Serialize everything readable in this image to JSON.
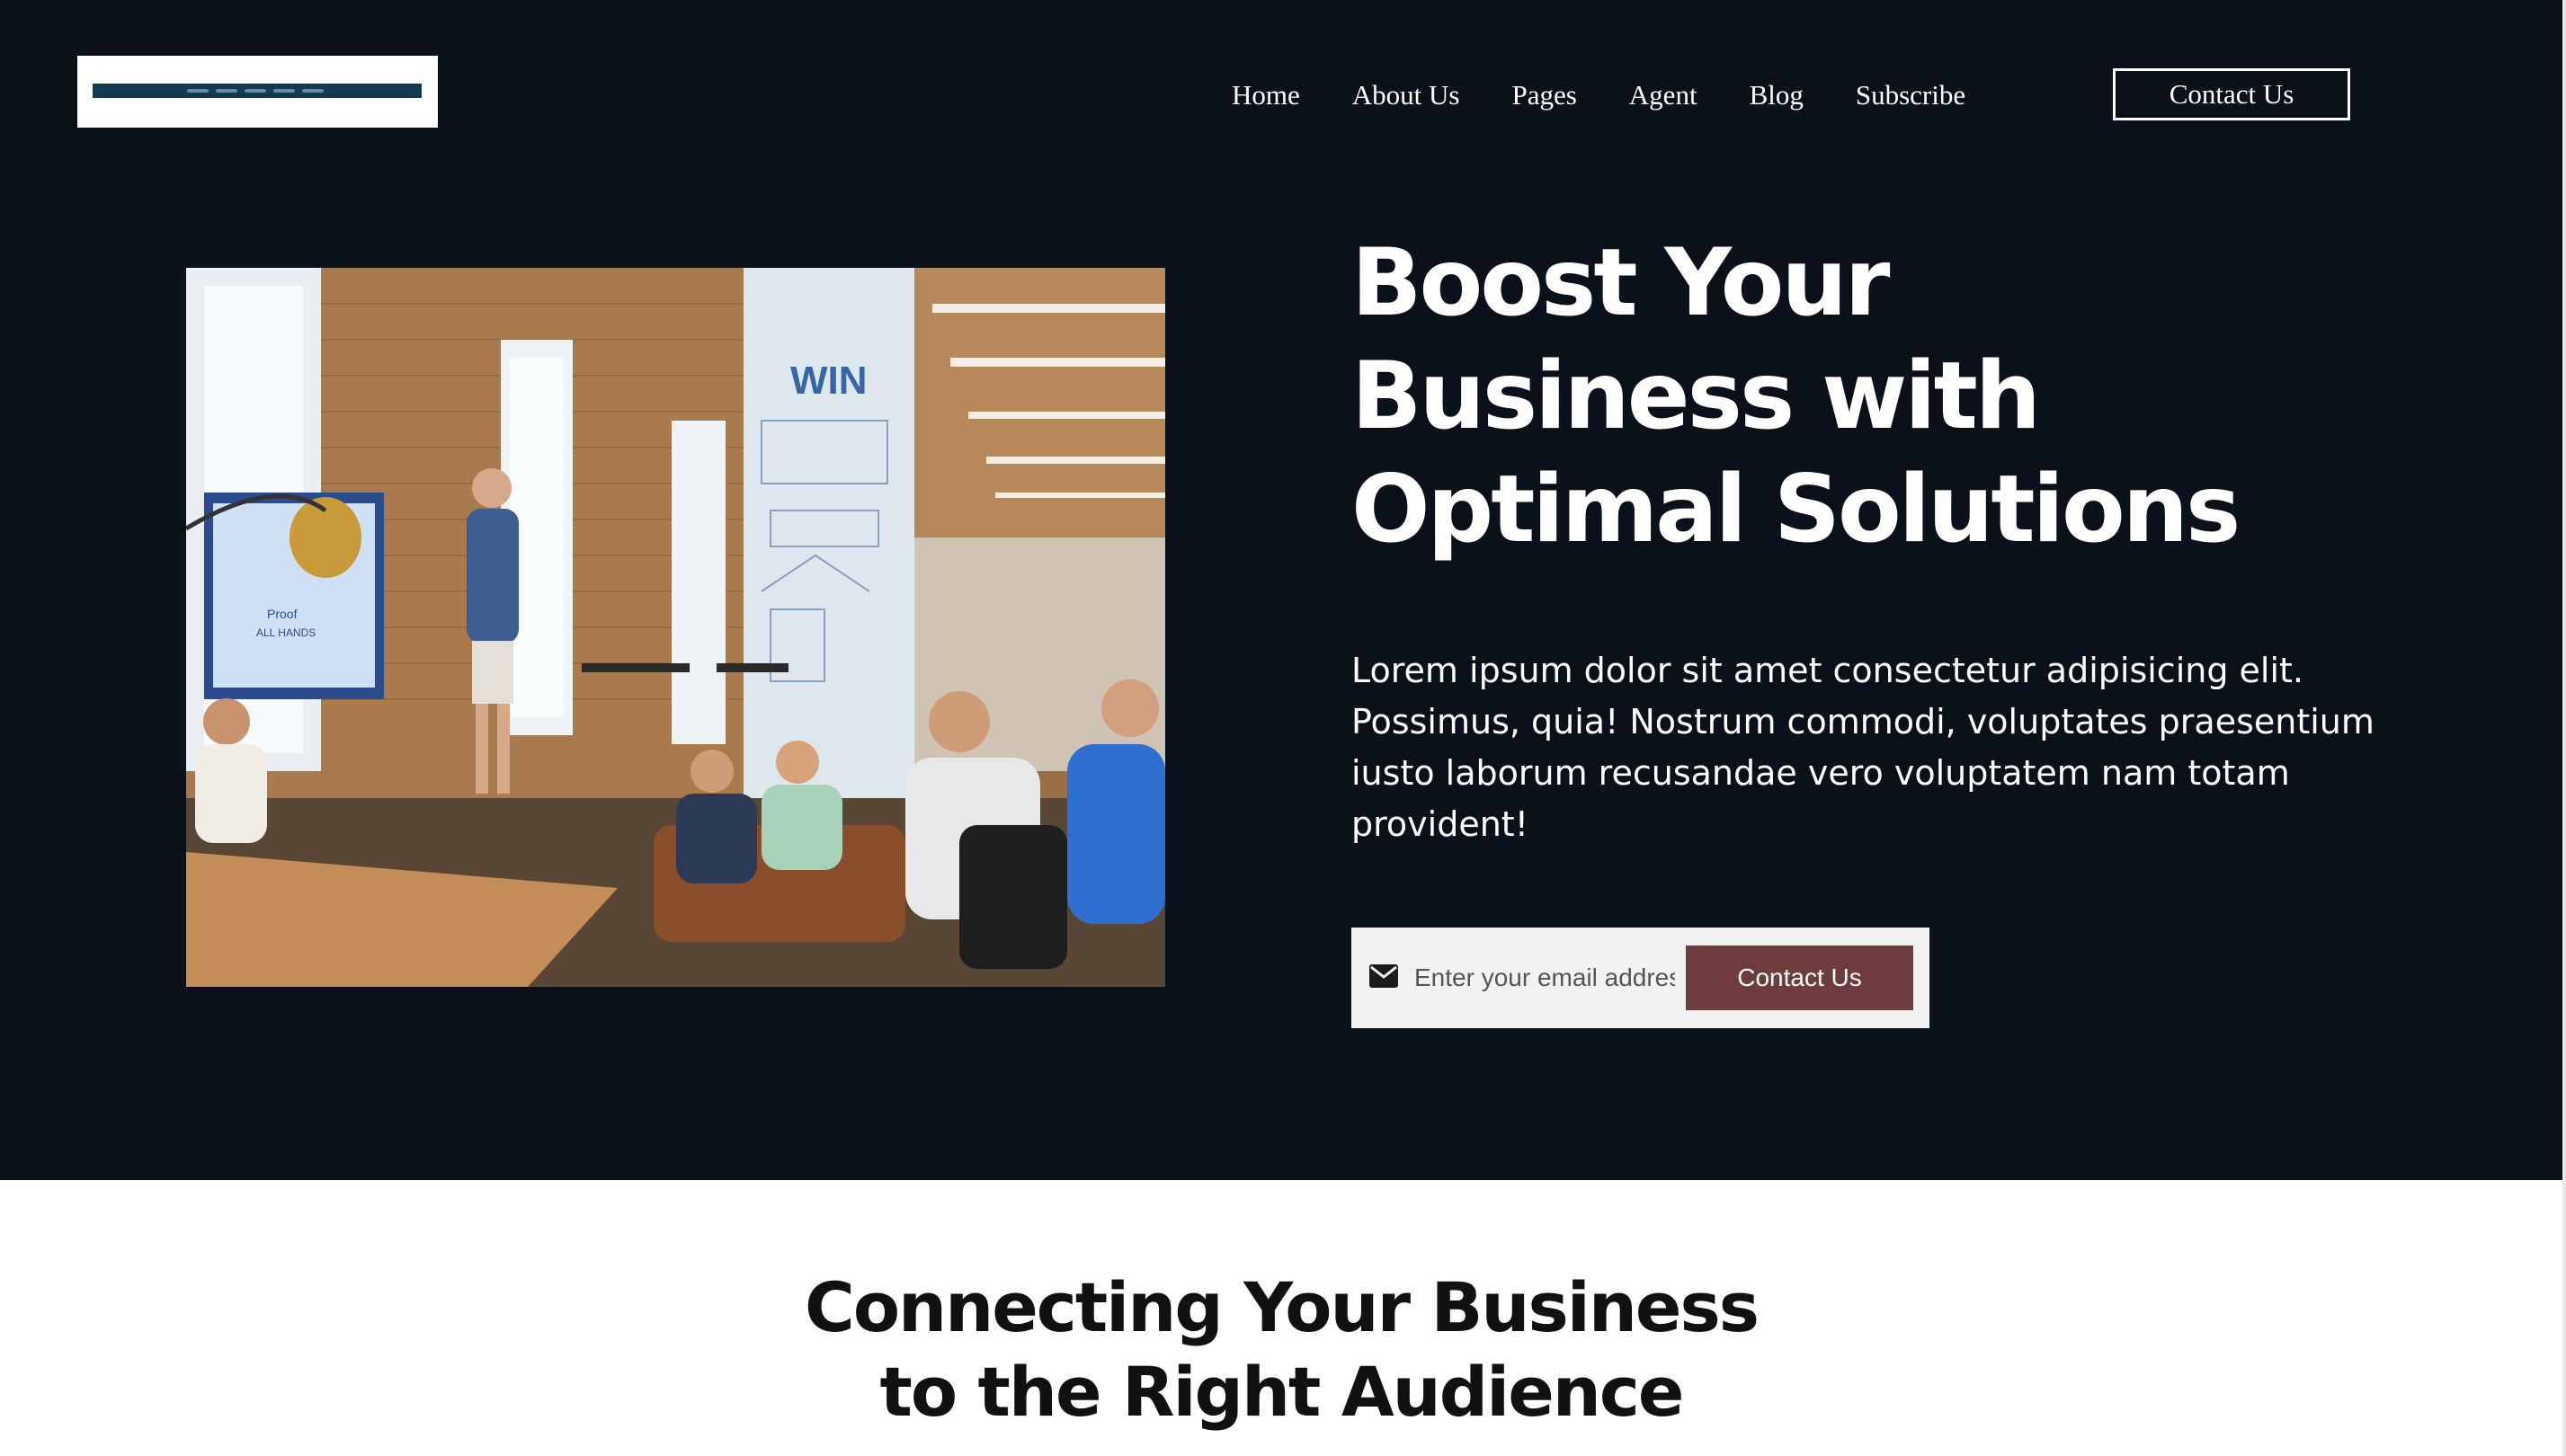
{
  "header": {
    "logo_alt": "Logo",
    "nav": [
      "Home",
      "About Us",
      "Pages",
      "Agent",
      "Blog",
      "Subscribe"
    ],
    "cta_label": "Contact Us"
  },
  "hero": {
    "image_alt": "Team meeting in a modern brick office",
    "title_lines": [
      "Boost Your",
      "Business with",
      "Optimal Solutions"
    ],
    "description": "Lorem ipsum dolor sit amet consectetur adipisicing elit. Possimus, quia! Nostrum commodi, voluptates praesentium iusto laborum recusandae vero voluptatem nam totam provident!",
    "email_placeholder": "Enter your email address",
    "form_button": "Contact Us"
  },
  "section": {
    "title_lines": [
      "Connecting Your Business",
      "to the Right Audience"
    ]
  },
  "colors": {
    "hero_background": "#0b111b",
    "button_accent": "#6e3c3c",
    "logo_bar": "#123a52"
  }
}
